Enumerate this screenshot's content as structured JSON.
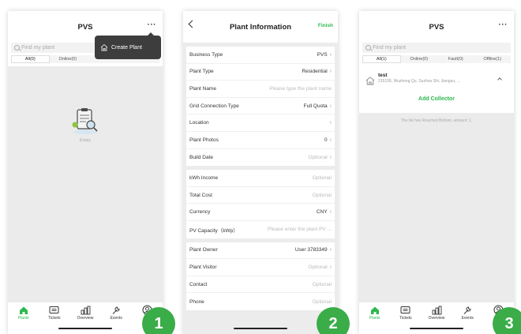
{
  "screen1": {
    "title": "PVS",
    "more": "···",
    "search_placeholder": "Find my plant",
    "filters": [
      "All(0)",
      "Online(0)"
    ],
    "popup_label": "Create Plant",
    "empty_text": "Empty",
    "step": "1"
  },
  "screen2": {
    "title": "Plant Information",
    "finish": "Finish",
    "groups": [
      [
        {
          "label": "Business Type",
          "value": "PVS",
          "placeholder": false,
          "arrow": true
        },
        {
          "label": "Plant Type",
          "value": "Residential",
          "placeholder": false,
          "arrow": true
        },
        {
          "label": "Plant Name",
          "value": "Please type the plant name",
          "placeholder": true,
          "arrow": false
        },
        {
          "label": "Grid Connection Type",
          "value": "Full Quota",
          "placeholder": false,
          "arrow": true
        },
        {
          "label": "Location",
          "value": "",
          "placeholder": false,
          "arrow": true
        },
        {
          "label": "Plant Photos",
          "value": "0",
          "placeholder": false,
          "arrow": true
        },
        {
          "label": "Build Date",
          "value": "Optional",
          "placeholder": true,
          "arrow": true
        }
      ],
      [
        {
          "label": "kWh Income",
          "value": "Optional",
          "placeholder": true,
          "arrow": false
        },
        {
          "label": "Total Cost",
          "value": "Optional",
          "placeholder": true,
          "arrow": false
        },
        {
          "label": "Currency",
          "value": "CNY",
          "placeholder": false,
          "arrow": true
        },
        {
          "label": "PV Capacity（kWp）",
          "value": "Please enter the plant PV ...",
          "placeholder": true,
          "arrow": false
        }
      ],
      [
        {
          "label": "Plant Owner",
          "value": "User 3783349",
          "placeholder": false,
          "arrow": true
        },
        {
          "label": "Plant Visitor",
          "value": "Optional",
          "placeholder": true,
          "arrow": true
        },
        {
          "label": "Contact",
          "value": "Optional",
          "placeholder": true,
          "arrow": false
        },
        {
          "label": "Phone",
          "value": "Optional",
          "placeholder": true,
          "arrow": false
        }
      ]
    ],
    "step": "2"
  },
  "screen3": {
    "title": "PVS",
    "more": "···",
    "search_placeholder": "Find my plant",
    "filters": [
      "All(1)",
      "Online(0)",
      "Fault(0)",
      "Offline(1)"
    ],
    "plant_name": "test",
    "plant_address": "215199, Wuzhong Qu, Suzhou Shi, Jiangsu, ...",
    "add_collector": "Add Collector",
    "list_end": "The list has Reached Bottom, amount: 1.",
    "step": "3"
  },
  "tabbar": {
    "items": [
      "Plants",
      "Tickets",
      "Overview",
      "Events",
      ""
    ]
  },
  "colors": {
    "accent_green": "#2db94d",
    "badge_green": "#3aac48",
    "popup_bg": "#3d3d3d"
  }
}
